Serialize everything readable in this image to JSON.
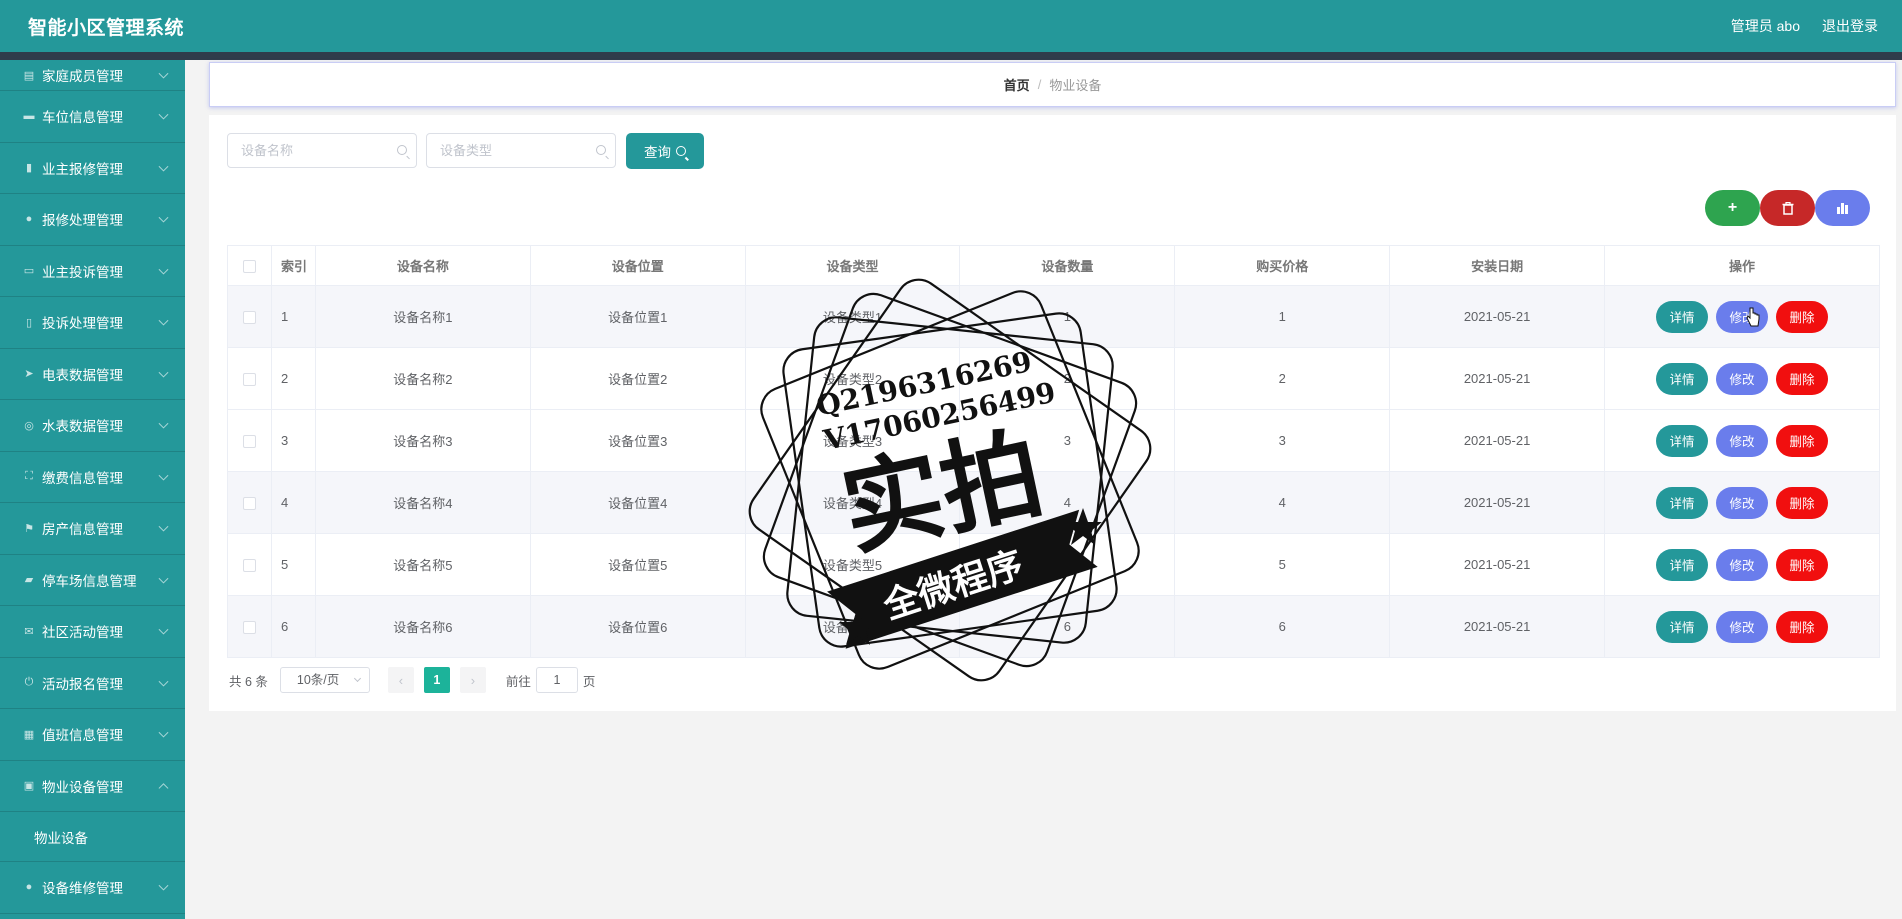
{
  "header": {
    "title": "智能小区管理系统",
    "user": "管理员 abo",
    "logout": "退出登录"
  },
  "sidebar": {
    "items": [
      {
        "label": "家庭成员管理",
        "icon": "doc-icon"
      },
      {
        "label": "车位信息管理",
        "icon": "car-icon"
      },
      {
        "label": "业主报修管理",
        "icon": "bar-chart-icon"
      },
      {
        "label": "报修处理管理",
        "icon": "user-icon"
      },
      {
        "label": "业主投诉管理",
        "icon": "comment-icon"
      },
      {
        "label": "投诉处理管理",
        "icon": "mic-icon"
      },
      {
        "label": "电表数据管理",
        "icon": "send-icon"
      },
      {
        "label": "水表数据管理",
        "icon": "compass-icon"
      },
      {
        "label": "缴费信息管理",
        "icon": "fullscreen-icon"
      },
      {
        "label": "房产信息管理",
        "icon": "flag-icon"
      },
      {
        "label": "停车场信息管理",
        "icon": "ticket-icon"
      },
      {
        "label": "社区活动管理",
        "icon": "mail-icon"
      },
      {
        "label": "活动报名管理",
        "icon": "power-icon"
      },
      {
        "label": "值班信息管理",
        "icon": "calendar-icon"
      },
      {
        "label": "物业设备管理",
        "icon": "monitor-icon"
      },
      {
        "label": "设备维修管理",
        "icon": "person-icon"
      }
    ],
    "sub_item": "物业设备"
  },
  "breadcrumb": {
    "home": "首页",
    "separator": "/",
    "current": "物业设备"
  },
  "search": {
    "name_placeholder": "设备名称",
    "type_placeholder": "设备类型",
    "query_label": "查询"
  },
  "actions": {
    "add": "+",
    "colors": {
      "add": "#2ea44f",
      "delete": "#c62828",
      "stats": "#6a7dec"
    }
  },
  "table": {
    "headers": [
      "索引",
      "设备名称",
      "设备位置",
      "设备类型",
      "设备数量",
      "购买价格",
      "安装日期",
      "操作"
    ],
    "rows": [
      {
        "index": "1",
        "name": "设备名称1",
        "location": "设备位置1",
        "type": "设备类型1",
        "quantity": "1",
        "price": "1",
        "date": "2021-05-21"
      },
      {
        "index": "2",
        "name": "设备名称2",
        "location": "设备位置2",
        "type": "设备类型2",
        "quantity": "2",
        "price": "2",
        "date": "2021-05-21"
      },
      {
        "index": "3",
        "name": "设备名称3",
        "location": "设备位置3",
        "type": "设备类型3",
        "quantity": "3",
        "price": "3",
        "date": "2021-05-21"
      },
      {
        "index": "4",
        "name": "设备名称4",
        "location": "设备位置4",
        "type": "设备类型4",
        "quantity": "4",
        "price": "4",
        "date": "2021-05-21"
      },
      {
        "index": "5",
        "name": "设备名称5",
        "location": "设备位置5",
        "type": "设备类型5",
        "quantity": "5",
        "price": "5",
        "date": "2021-05-21"
      },
      {
        "index": "6",
        "name": "设备名称6",
        "location": "设备位置6",
        "type": "设备类型6",
        "quantity": "6",
        "price": "6",
        "date": "2021-05-21"
      }
    ],
    "op_labels": {
      "detail": "详情",
      "edit": "修改",
      "delete": "删除"
    }
  },
  "pagination": {
    "total": "共 6 条",
    "page_size": "10条/页",
    "current_page": "1",
    "goto_prefix": "前往",
    "goto_value": "1",
    "goto_suffix": "页"
  },
  "watermark": {
    "line1": "Q2196316269",
    "line2": "V17060256499",
    "main": "实拍",
    "banner": "全微程序"
  }
}
